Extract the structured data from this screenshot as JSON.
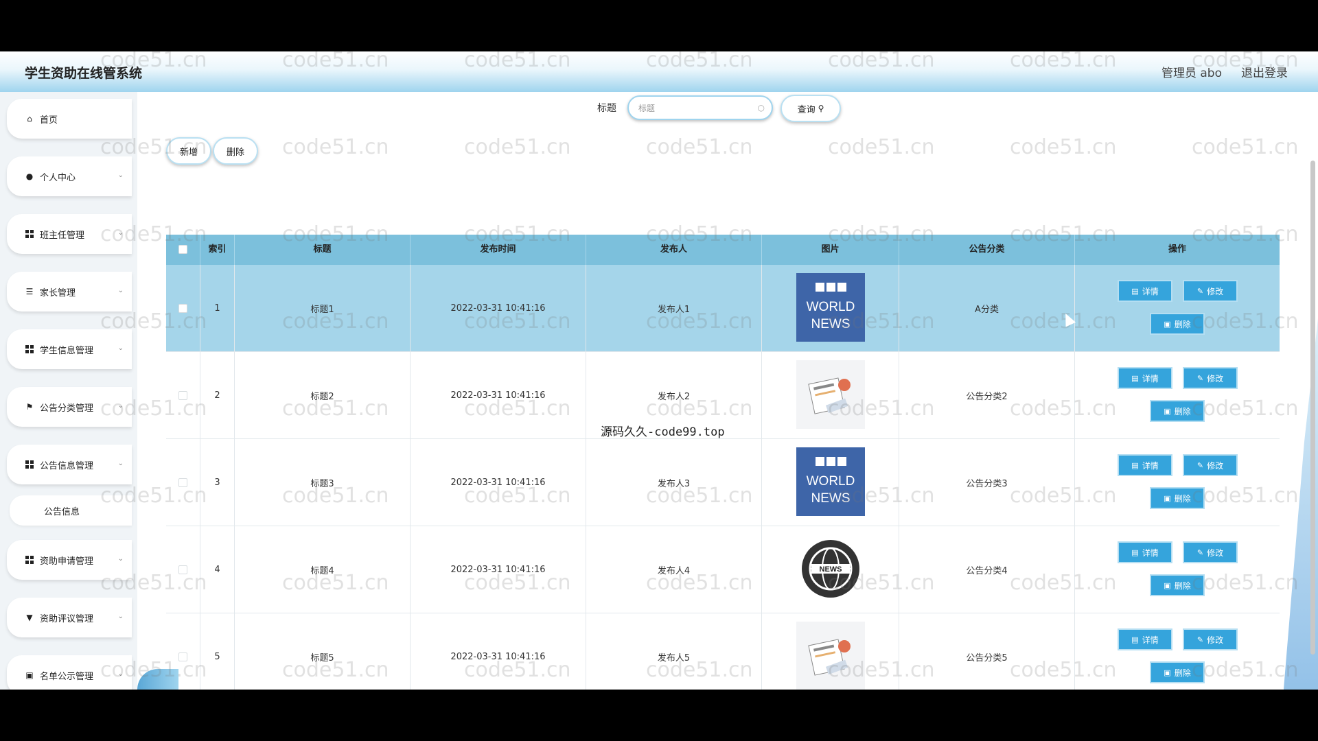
{
  "app": {
    "title": "学生资助在线管系统",
    "user": "管理员 abo",
    "logout": "退出登录"
  },
  "sidebar": {
    "items": [
      {
        "label": "首页",
        "icon": "home-icon"
      },
      {
        "label": "个人中心",
        "icon": "user-icon"
      },
      {
        "label": "班主任管理",
        "icon": "grid-icon"
      },
      {
        "label": "家长管理",
        "icon": "list-icon"
      },
      {
        "label": "学生信息管理",
        "icon": "grid-icon"
      },
      {
        "label": "公告分类管理",
        "icon": "flag-icon"
      },
      {
        "label": "公告信息管理",
        "icon": "grid-icon"
      },
      {
        "label": "资助申请管理",
        "icon": "grid-icon"
      },
      {
        "label": "资助评议管理",
        "icon": "cup-icon"
      },
      {
        "label": "名单公示管理",
        "icon": "briefcase-icon"
      }
    ],
    "sub_item": "公告信息"
  },
  "search": {
    "label": "标题",
    "placeholder": "标题",
    "button": "查询"
  },
  "toolbar": {
    "add": "新增",
    "delete": "删除"
  },
  "table": {
    "headers": [
      "索引",
      "标题",
      "发布时间",
      "发布人",
      "图片",
      "公告分类",
      "操作"
    ],
    "rows": [
      {
        "index": "1",
        "title": "标题1",
        "time": "2022-03-31 10:41:16",
        "publisher": "发布人1",
        "image": "bbc-world-news",
        "category": "A分类"
      },
      {
        "index": "2",
        "title": "标题2",
        "time": "2022-03-31 10:41:16",
        "publisher": "发布人2",
        "image": "news-paper",
        "category": "公告分类2"
      },
      {
        "index": "3",
        "title": "标题3",
        "time": "2022-03-31 10:41:16",
        "publisher": "发布人3",
        "image": "bbc-world-news",
        "category": "公告分类3"
      },
      {
        "index": "4",
        "title": "标题4",
        "time": "2022-03-31 10:41:16",
        "publisher": "发布人4",
        "image": "news-globe",
        "category": "公告分类4"
      },
      {
        "index": "5",
        "title": "标题5",
        "time": "2022-03-31 10:41:16",
        "publisher": "发布人5",
        "image": "news-paper",
        "category": "公告分类5"
      }
    ],
    "actions": {
      "detail": "详情",
      "edit": "修改",
      "delete": "删除"
    }
  },
  "watermark": {
    "center": "源码久久-code99.top",
    "tile": "code51.cn"
  },
  "colors": {
    "header": "#7cc0dc",
    "selected_row": "#a5d5ea",
    "action_button": "#35a4dc"
  }
}
